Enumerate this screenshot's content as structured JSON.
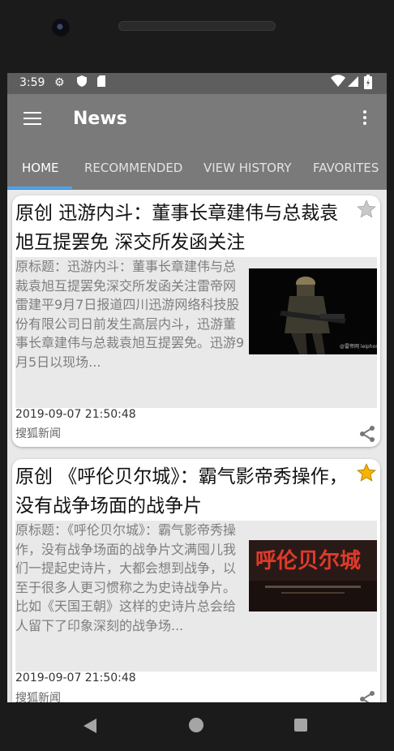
{
  "status": {
    "time": "3:59"
  },
  "app": {
    "title": "News"
  },
  "tabs": [
    {
      "label": "HOME"
    },
    {
      "label": "RECOMMENDED"
    },
    {
      "label": "VIEW HISTORY"
    },
    {
      "label": "FAVORITES"
    }
  ],
  "articles": [
    {
      "title": "原创 迅游内斗：董事长章建伟与总裁袁旭互提罢免 深交所发函关注",
      "summary": "原标题：迅游内斗：董事长章建伟与总裁袁旭互提罢免深交所发函关注雷帝网雷建平9月7日报道四川迅游网络科技股份有限公司日前发生高层内斗，迅游董事长章建伟与总裁袁旭互提罢免。迅游9月5日以现场...",
      "timestamp": "2019-09-07 21:50:48",
      "source": "搜狐新闻",
      "favorited": false,
      "watermark": "@雷帝网 leiphone"
    },
    {
      "title": "原创 《呼伦贝尔城》：霸气影帝秀操作，没有战争场面的战争片",
      "summary": "原标题：《呼伦贝尔城》：霸气影帝秀操作，没有战争场面的战争片文满囤儿我们一提起史诗片，大都会想到战争，以至于很多人更习惯称之为史诗战争片。比如《天国王朝》这样的史诗片总会给人留下了印象深刻的战争场...",
      "timestamp": "2019-09-07 21:50:48",
      "source": "搜狐新闻",
      "favorited": true,
      "poster_text": "呼伦贝尔城"
    }
  ],
  "colors": {
    "appbar": "#7a7a7a",
    "statusbar": "#5e5e5e",
    "tab_indicator": "#4aa3f5",
    "star_on": "#f5b400",
    "star_off": "#c8c8c8"
  }
}
